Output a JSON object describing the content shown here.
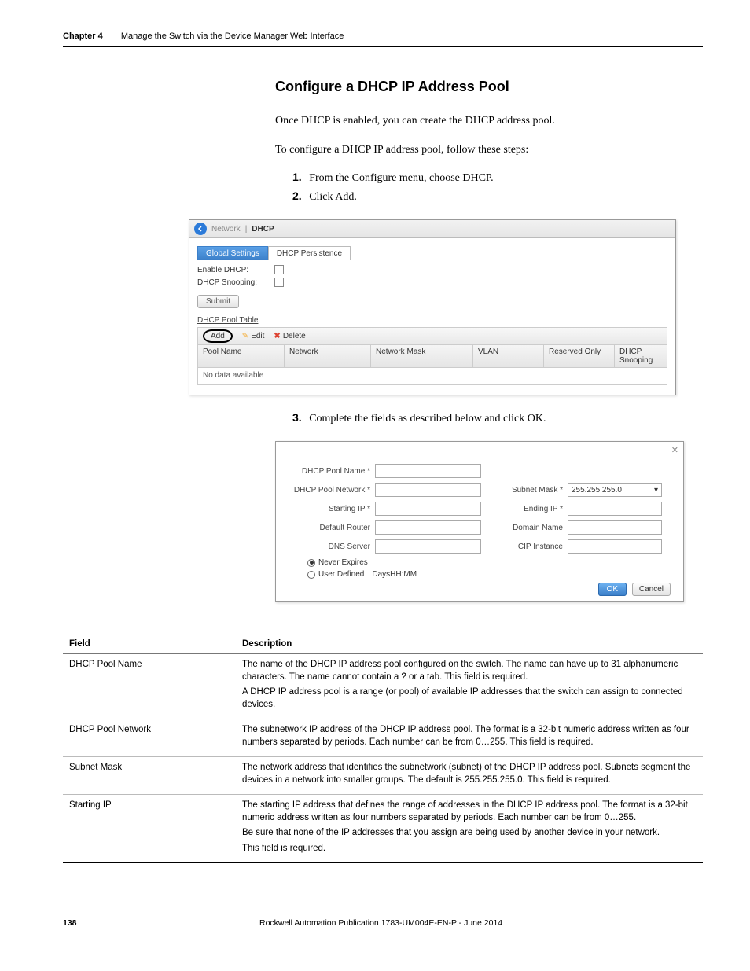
{
  "header": {
    "chapter": "Chapter 4",
    "title": "Manage the Switch via the Device Manager Web Interface"
  },
  "section": {
    "heading": "Configure a DHCP IP Address Pool",
    "intro1": "Once DHCP is enabled, you can create the DHCP address pool.",
    "intro2": "To configure a DHCP IP address pool, follow these steps:",
    "steps": {
      "s1": {
        "num": "1.",
        "text": "From the Configure menu, choose DHCP."
      },
      "s2": {
        "num": "2.",
        "text": "Click Add."
      },
      "s3": {
        "num": "3.",
        "text": "Complete the fields as described below and click OK."
      }
    }
  },
  "shot1": {
    "crumb_first": "Network",
    "crumb_sep": "|",
    "crumb_last": "DHCP",
    "tab_global": "Global Settings",
    "tab_persist": "DHCP Persistence",
    "enable_label": "Enable DHCP:",
    "snoop_label": "DHCP Snooping:",
    "submit": "Submit",
    "pool_table_title": "DHCP Pool Table",
    "add": "Add",
    "edit": "Edit",
    "delete": "Delete",
    "cols": {
      "pool": "Pool Name",
      "net": "Network",
      "mask": "Network Mask",
      "vlan": "VLAN",
      "res": "Reserved Only",
      "snoop": "DHCP Snooping"
    },
    "no_data": "No data available"
  },
  "shot2": {
    "labels": {
      "pool_name": "DHCP Pool Name *",
      "pool_network": "DHCP Pool Network *",
      "subnet": "Subnet Mask *",
      "subnet_value": "255.255.255.0",
      "start_ip": "Starting IP *",
      "end_ip": "Ending IP *",
      "default_router": "Default Router",
      "domain_name": "Domain Name",
      "dns": "DNS Server",
      "cip": "CIP Instance",
      "never": "Never Expires",
      "user_def": "User Defined",
      "days": "Days",
      "hhmm": "HH:MM"
    },
    "ok": "OK",
    "cancel": "Cancel"
  },
  "fields_table": {
    "head_field": "Field",
    "head_desc": "Description",
    "rows": [
      {
        "field": "DHCP Pool Name",
        "desc": [
          "The name of the DHCP IP address pool configured on the switch. The name can have up to 31 alphanumeric characters. The name cannot contain a ? or a tab. This field is required.",
          "A DHCP IP address pool is a range (or pool) of available IP addresses that the switch can assign to connected devices."
        ]
      },
      {
        "field": "DHCP Pool Network",
        "desc": [
          "The subnetwork IP address of the DHCP IP address pool. The format is a 32-bit numeric address written as four numbers separated by periods. Each number can be from 0…255. This field is required."
        ]
      },
      {
        "field": "Subnet Mask",
        "desc": [
          "The network address that identifies the subnetwork (subnet) of the DHCP IP address pool. Subnets segment the devices in a network into smaller groups. The default is 255.255.255.0. This field is required."
        ]
      },
      {
        "field": "Starting IP",
        "desc": [
          "The starting IP address that defines the range of addresses in the DHCP IP address pool. The format is a 32-bit numeric address written as four numbers separated by periods. Each number can be from 0…255.",
          "Be sure that none of the IP addresses that you assign are being used by another device in your network.",
          "This field is required."
        ]
      }
    ]
  },
  "footer": {
    "page": "138",
    "pub": "Rockwell Automation Publication 1783-UM004E-EN-P - June 2014"
  },
  "chart_data": null
}
